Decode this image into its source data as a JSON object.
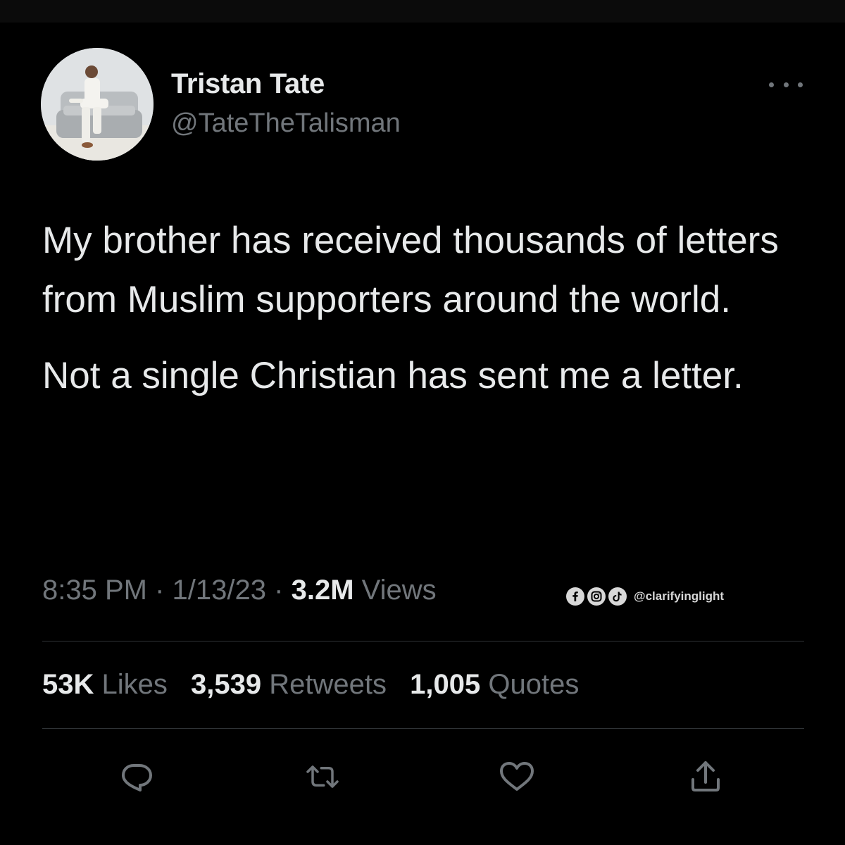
{
  "author": {
    "display_name": "Tristan Tate",
    "handle": "@TateTheTalisman"
  },
  "tweet": {
    "paragraphs": [
      "My brother has received thousands of letters from Muslim supporters around the world.",
      "Not a single Christian has sent me a letter."
    ]
  },
  "meta": {
    "time": "8:35 PM",
    "separator": "·",
    "date": "1/13/23",
    "views_count": "3.2M",
    "views_label": "Views"
  },
  "watermark": {
    "icons": [
      "facebook-icon",
      "instagram-icon",
      "tiktok-icon"
    ],
    "handle": "@clarifyinglight"
  },
  "stats": {
    "likes_count": "53K",
    "likes_label": "Likes",
    "retweets_count": "3,539",
    "retweets_label": "Retweets",
    "quotes_count": "1,005",
    "quotes_label": "Quotes"
  },
  "actions": [
    "reply-icon",
    "retweet-icon",
    "like-icon",
    "share-icon"
  ],
  "colors": {
    "background": "#000000",
    "primary_text": "#e7e9ea",
    "secondary_text": "#71767b",
    "divider": "#2f3336"
  }
}
